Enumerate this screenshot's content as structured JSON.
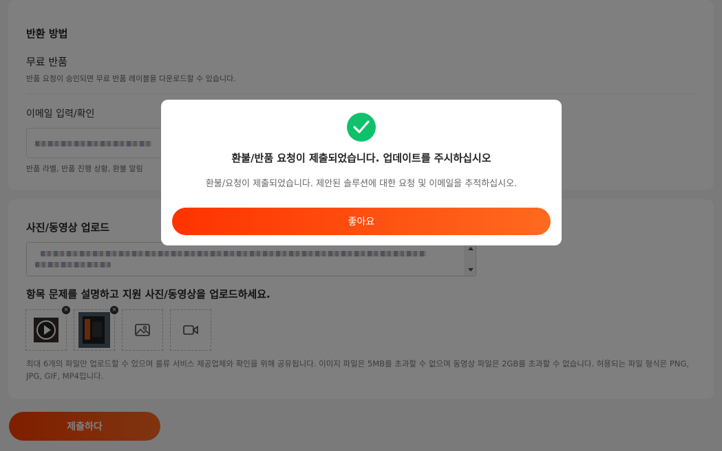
{
  "return_method": {
    "title": "반환 방법",
    "option_title": "무료 반품",
    "option_desc": "반품 요청이 승인되면 무료 반품 레이블을 다운로드할 수 있습니다."
  },
  "email": {
    "label": "이메일 입력/확인",
    "hint": "반품 라벨, 반품 진행 상황, 환불 알림"
  },
  "upload": {
    "title": "사진/동영상 업로드",
    "prompt": "항목 문제를 설명하고 지원 사진/동영상을 업로드하세요.",
    "remove_glyph": "×",
    "note": "최대 6개의 파일만 업로드할 수 있으며 룰류 서비스 제공업체와 확인을 위해 공유됩니다. 이미지 파일은 5MB를 초과할 수 없으며 동영상 파일은 2GB를 초과할 수 없습니다. 허용되는 파일 형식은 PNG, JPG, GIF, MP4입니다.",
    "icons": [
      "video-thumbnail-icon",
      "photo-thumbnail-icon",
      "add-image-icon",
      "add-video-icon"
    ]
  },
  "submit_label": "제출하다",
  "modal": {
    "icon": "check-circle-icon",
    "title": "환불/반품 요청이 제출되었습니다. 업데이트를 주시하십시오",
    "description": "환불/요청이 제출되었습니다. 제안된 솔루션에 대한 요청 및 이메일을 추적하십시오.",
    "ok_label": "좋아요"
  },
  "colors": {
    "accent": "#ff3d00",
    "success": "#0ec16a"
  }
}
